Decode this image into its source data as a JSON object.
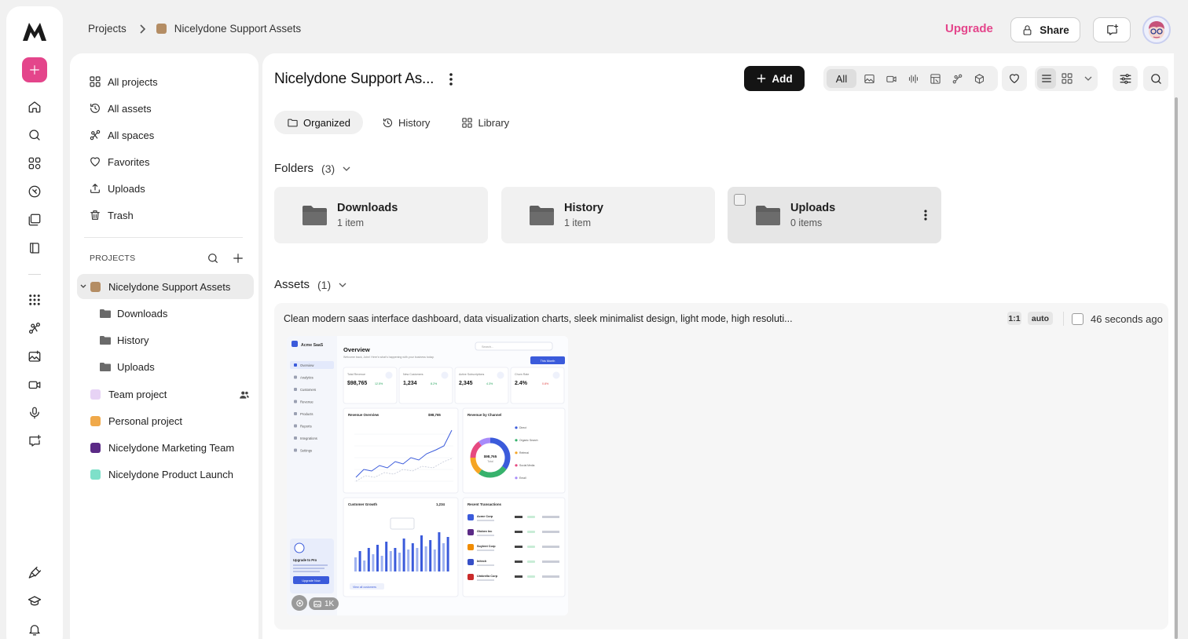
{
  "breadcrumb": {
    "root": "Projects",
    "current": "Nicelydone Support Assets"
  },
  "header": {
    "upgrade_label": "Upgrade",
    "share_label": "Share"
  },
  "sidebar": {
    "nav": [
      {
        "label": "All projects",
        "icon": "grid-icon"
      },
      {
        "label": "All assets",
        "icon": "history-icon"
      },
      {
        "label": "All spaces",
        "icon": "spaces-icon"
      },
      {
        "label": "Favorites",
        "icon": "heart-icon"
      },
      {
        "label": "Uploads",
        "icon": "upload-icon"
      },
      {
        "label": "Trash",
        "icon": "trash-icon"
      }
    ],
    "projects_header": "PROJECTS",
    "projects": [
      {
        "label": "Nicelydone Support Assets",
        "color": "#b48d64"
      },
      {
        "label": "Team project",
        "color": "#e7d3f5"
      },
      {
        "label": "Personal project",
        "color": "#f0a94a"
      },
      {
        "label": "Nicelydone Marketing Team",
        "color": "#5b2a86"
      },
      {
        "label": "Nicelydone Product Launch",
        "color": "#7ee0c9"
      }
    ],
    "subfolders": [
      "Downloads",
      "History",
      "Uploads"
    ]
  },
  "main": {
    "title": "Nicelydone Support As...",
    "add_label": "Add",
    "filter_all": "All",
    "tabs": [
      "Organized",
      "History",
      "Library"
    ],
    "folders_header": "Folders",
    "folders_count": "(3)",
    "folders": [
      {
        "name": "Downloads",
        "count": "1 item"
      },
      {
        "name": "History",
        "count": "1 item"
      },
      {
        "name": "Uploads",
        "count": "0 items"
      }
    ],
    "assets_header": "Assets",
    "assets_count": "(1)",
    "asset": {
      "prompt": "Clean modern saas interface dashboard, data visualization charts, sleek minimalist design, light mode, high resoluti...",
      "ratio": "1:1",
      "mode": "auto",
      "time": "46 seconds ago",
      "badge": "1K"
    }
  },
  "thumbnail": {
    "brand": "Acme SaaS",
    "title": "Overview",
    "subtitle": "Welcome back, John! Here's what's happening with your business today.",
    "search": "Search...",
    "period": "This Month",
    "nav": [
      "Overview",
      "Analytics",
      "Customers",
      "Revenue",
      "Products",
      "Reports",
      "Integrations",
      "Settings"
    ],
    "kpis": [
      {
        "label": "Total Revenue",
        "value": "$98,765",
        "delta": "12.5%",
        "color": "#22a35a"
      },
      {
        "label": "New Customers",
        "value": "1,234",
        "delta": "8.2%",
        "color": "#22a35a"
      },
      {
        "label": "Active Subscriptions",
        "value": "2,345",
        "delta": "4.3%",
        "color": "#22a35a"
      },
      {
        "label": "Churn Rate",
        "value": "2.4%",
        "delta": "0.8%",
        "color": "#e04848"
      }
    ],
    "revenue_title": "Revenue Overview",
    "revenue_value": "$98,765",
    "channel_title": "Revenue by Channel",
    "donut_value": "$98,765",
    "donut_label": "Total",
    "channels": [
      "Direct",
      "Organic Search",
      "Referral",
      "Social Media",
      "Email"
    ],
    "growth_title": "Customer Growth",
    "growth_value": "1,234",
    "tx_title": "Recent Transactions",
    "tx": [
      "Acme Corp",
      "Globex Inc",
      "Soylent Corp",
      "Initech",
      "Umbrella Corp"
    ],
    "upgrade_title": "Upgrade to Pro",
    "upgrade_btn": "Upgrade Now",
    "view_all": "View all customers"
  }
}
